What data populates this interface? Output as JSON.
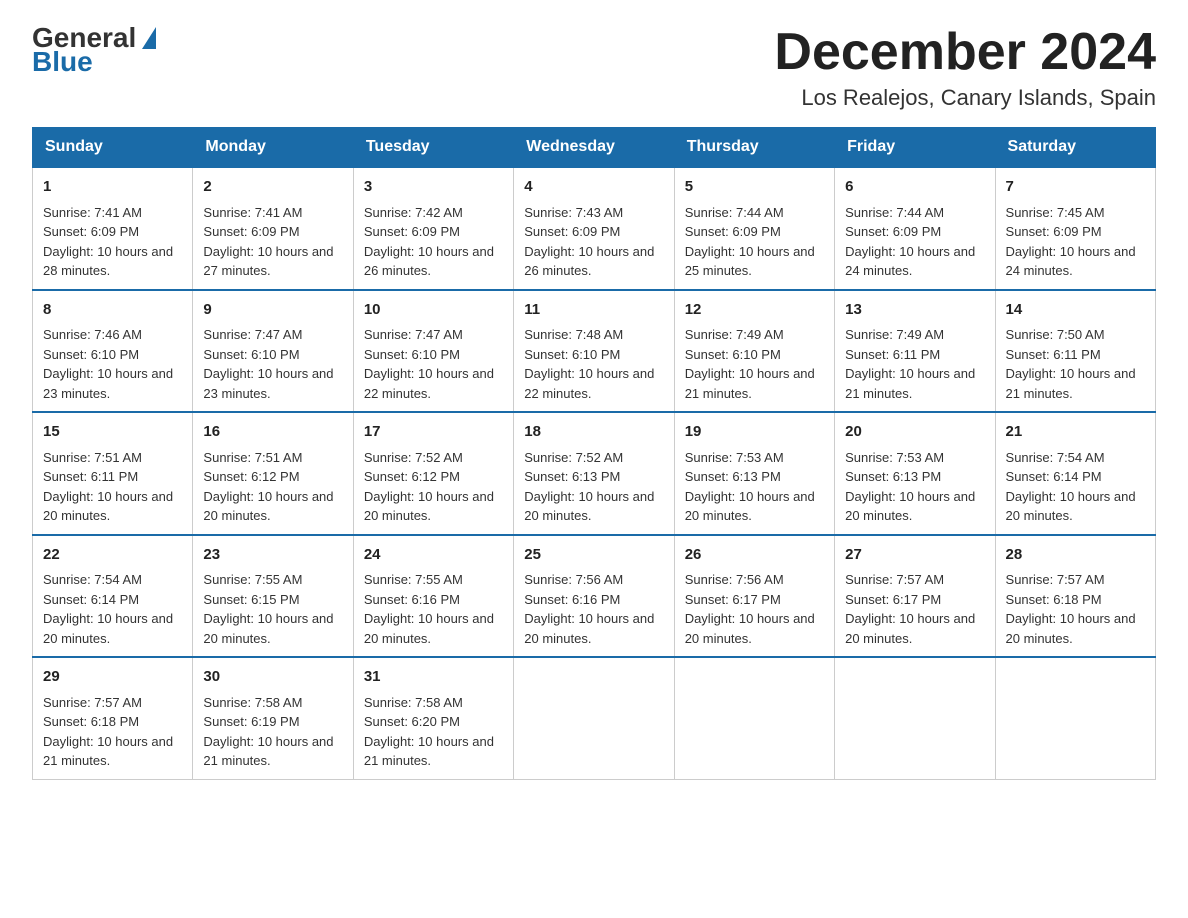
{
  "header": {
    "logo_general": "General",
    "logo_blue": "Blue",
    "month_title": "December 2024",
    "location": "Los Realejos, Canary Islands, Spain"
  },
  "days_of_week": [
    "Sunday",
    "Monday",
    "Tuesday",
    "Wednesday",
    "Thursday",
    "Friday",
    "Saturday"
  ],
  "weeks": [
    [
      {
        "day": "1",
        "sunrise": "7:41 AM",
        "sunset": "6:09 PM",
        "daylight": "10 hours and 28 minutes."
      },
      {
        "day": "2",
        "sunrise": "7:41 AM",
        "sunset": "6:09 PM",
        "daylight": "10 hours and 27 minutes."
      },
      {
        "day": "3",
        "sunrise": "7:42 AM",
        "sunset": "6:09 PM",
        "daylight": "10 hours and 26 minutes."
      },
      {
        "day": "4",
        "sunrise": "7:43 AM",
        "sunset": "6:09 PM",
        "daylight": "10 hours and 26 minutes."
      },
      {
        "day": "5",
        "sunrise": "7:44 AM",
        "sunset": "6:09 PM",
        "daylight": "10 hours and 25 minutes."
      },
      {
        "day": "6",
        "sunrise": "7:44 AM",
        "sunset": "6:09 PM",
        "daylight": "10 hours and 24 minutes."
      },
      {
        "day": "7",
        "sunrise": "7:45 AM",
        "sunset": "6:09 PM",
        "daylight": "10 hours and 24 minutes."
      }
    ],
    [
      {
        "day": "8",
        "sunrise": "7:46 AM",
        "sunset": "6:10 PM",
        "daylight": "10 hours and 23 minutes."
      },
      {
        "day": "9",
        "sunrise": "7:47 AM",
        "sunset": "6:10 PM",
        "daylight": "10 hours and 23 minutes."
      },
      {
        "day": "10",
        "sunrise": "7:47 AM",
        "sunset": "6:10 PM",
        "daylight": "10 hours and 22 minutes."
      },
      {
        "day": "11",
        "sunrise": "7:48 AM",
        "sunset": "6:10 PM",
        "daylight": "10 hours and 22 minutes."
      },
      {
        "day": "12",
        "sunrise": "7:49 AM",
        "sunset": "6:10 PM",
        "daylight": "10 hours and 21 minutes."
      },
      {
        "day": "13",
        "sunrise": "7:49 AM",
        "sunset": "6:11 PM",
        "daylight": "10 hours and 21 minutes."
      },
      {
        "day": "14",
        "sunrise": "7:50 AM",
        "sunset": "6:11 PM",
        "daylight": "10 hours and 21 minutes."
      }
    ],
    [
      {
        "day": "15",
        "sunrise": "7:51 AM",
        "sunset": "6:11 PM",
        "daylight": "10 hours and 20 minutes."
      },
      {
        "day": "16",
        "sunrise": "7:51 AM",
        "sunset": "6:12 PM",
        "daylight": "10 hours and 20 minutes."
      },
      {
        "day": "17",
        "sunrise": "7:52 AM",
        "sunset": "6:12 PM",
        "daylight": "10 hours and 20 minutes."
      },
      {
        "day": "18",
        "sunrise": "7:52 AM",
        "sunset": "6:13 PM",
        "daylight": "10 hours and 20 minutes."
      },
      {
        "day": "19",
        "sunrise": "7:53 AM",
        "sunset": "6:13 PM",
        "daylight": "10 hours and 20 minutes."
      },
      {
        "day": "20",
        "sunrise": "7:53 AM",
        "sunset": "6:13 PM",
        "daylight": "10 hours and 20 minutes."
      },
      {
        "day": "21",
        "sunrise": "7:54 AM",
        "sunset": "6:14 PM",
        "daylight": "10 hours and 20 minutes."
      }
    ],
    [
      {
        "day": "22",
        "sunrise": "7:54 AM",
        "sunset": "6:14 PM",
        "daylight": "10 hours and 20 minutes."
      },
      {
        "day": "23",
        "sunrise": "7:55 AM",
        "sunset": "6:15 PM",
        "daylight": "10 hours and 20 minutes."
      },
      {
        "day": "24",
        "sunrise": "7:55 AM",
        "sunset": "6:16 PM",
        "daylight": "10 hours and 20 minutes."
      },
      {
        "day": "25",
        "sunrise": "7:56 AM",
        "sunset": "6:16 PM",
        "daylight": "10 hours and 20 minutes."
      },
      {
        "day": "26",
        "sunrise": "7:56 AM",
        "sunset": "6:17 PM",
        "daylight": "10 hours and 20 minutes."
      },
      {
        "day": "27",
        "sunrise": "7:57 AM",
        "sunset": "6:17 PM",
        "daylight": "10 hours and 20 minutes."
      },
      {
        "day": "28",
        "sunrise": "7:57 AM",
        "sunset": "6:18 PM",
        "daylight": "10 hours and 20 minutes."
      }
    ],
    [
      {
        "day": "29",
        "sunrise": "7:57 AM",
        "sunset": "6:18 PM",
        "daylight": "10 hours and 21 minutes."
      },
      {
        "day": "30",
        "sunrise": "7:58 AM",
        "sunset": "6:19 PM",
        "daylight": "10 hours and 21 minutes."
      },
      {
        "day": "31",
        "sunrise": "7:58 AM",
        "sunset": "6:20 PM",
        "daylight": "10 hours and 21 minutes."
      },
      null,
      null,
      null,
      null
    ]
  ]
}
